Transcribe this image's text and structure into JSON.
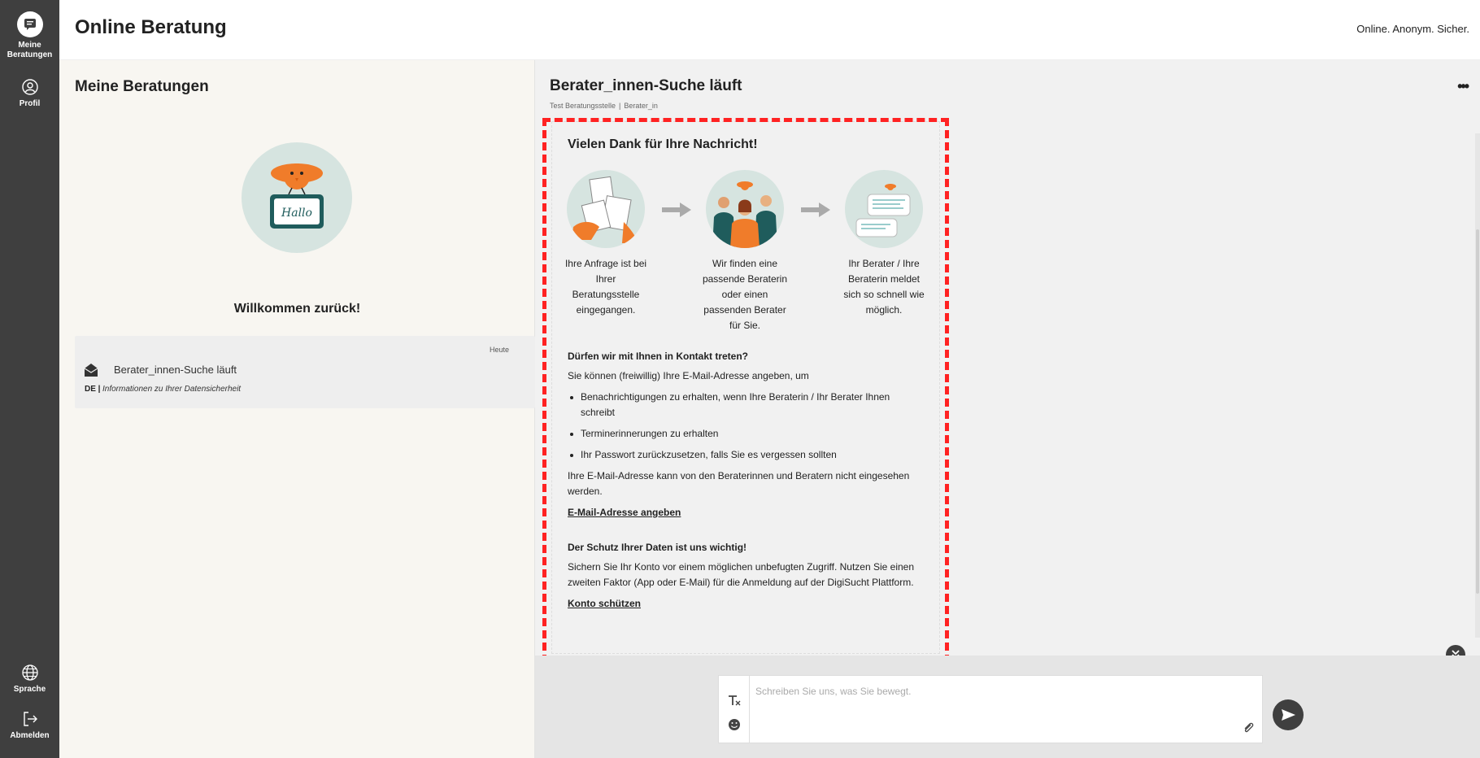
{
  "app": {
    "title": "Online Beratung",
    "tagline": "Online. Anonym. Sicher."
  },
  "nav": {
    "items": [
      {
        "label": "Meine Beratungen",
        "icon": "chat-bubble-icon"
      },
      {
        "label": "Profil",
        "icon": "user-icon"
      }
    ],
    "bottom": [
      {
        "label": "Sprache",
        "icon": "globe-icon"
      },
      {
        "label": "Abmelden",
        "icon": "logout-icon"
      }
    ]
  },
  "sessions": {
    "title": "Meine Beratungen",
    "welcome": "Willkommen zurück!",
    "illustration_text": "Hallo",
    "items": [
      {
        "date": "Heute",
        "subject": "Berater_innen-Suche läuft",
        "lang": "DE |",
        "preview": "Informationen zu Ihrer Datensicherheit"
      }
    ]
  },
  "chat": {
    "title": "Berater_innen-Suche läuft",
    "agency": "Test Beratungsstelle",
    "separator": "|",
    "role": "Berater_in",
    "more": "•••",
    "message": {
      "title": "Vielen Dank für Ihre Nachricht!",
      "steps": [
        "Ihre Anfrage ist bei Ihrer Beratungsstelle eingegangen.",
        "Wir finden eine passende Beraterin oder einen passenden Berater für Sie.",
        "Ihr Berater / Ihre Beraterin meldet sich so schnell wie möglich."
      ],
      "contact_heading": "Dürfen wir mit Ihnen in Kontakt treten?",
      "contact_intro": "Sie können (freiwillig) Ihre E-Mail-Adresse angeben, um",
      "contact_bullets": [
        "Benachrichtigungen zu erhalten, wenn Ihre Beraterin / Ihr Berater Ihnen schreibt",
        "Terminerinnerungen zu erhalten",
        "Ihr Passwort zurückzusetzen, falls Sie es vergessen sollten"
      ],
      "contact_note": "Ihre E-Mail-Adresse kann von den Beraterinnen und Beratern nicht eingesehen werden.",
      "email_link": "E-Mail-Adresse angeben",
      "security_heading": "Der Schutz Ihrer Daten ist uns wichtig!",
      "security_text": "Sichern Sie Ihr Konto vor einem möglichen unbefugten Zugriff. Nutzen Sie einen zweiten Faktor (App oder E-Mail) für die Anmeldung auf der DigiSucht Plattform.",
      "security_link": "Konto schützen"
    },
    "composer": {
      "placeholder": "Schreiben Sie uns, was Sie bewegt."
    }
  },
  "colors": {
    "nav_bg": "#3f3f3f",
    "list_bg": "#f8f6f1",
    "chat_bg": "#f1f1f1",
    "illustration_bg": "#d6e4e0",
    "accent_orange": "#f07c2a",
    "accent_teal": "#1f5c5c",
    "highlight_dash": "#ff2222"
  }
}
